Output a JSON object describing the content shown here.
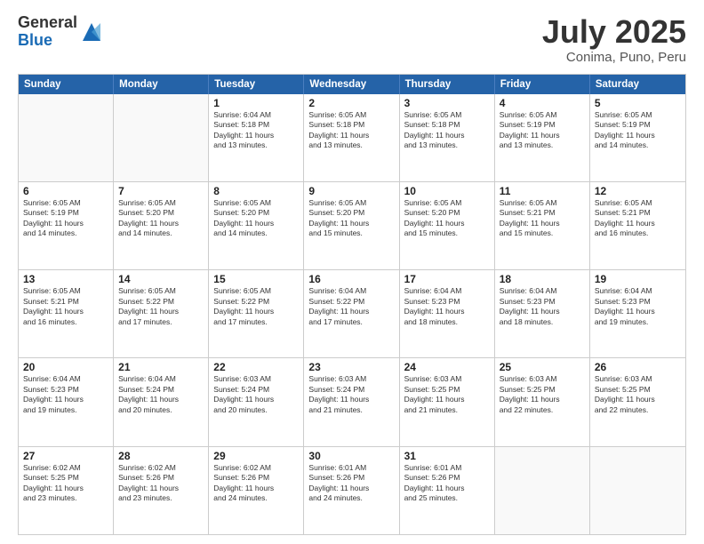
{
  "logo": {
    "general": "General",
    "blue": "Blue"
  },
  "title": "July 2025",
  "subtitle": "Conima, Puno, Peru",
  "header_days": [
    "Sunday",
    "Monday",
    "Tuesday",
    "Wednesday",
    "Thursday",
    "Friday",
    "Saturday"
  ],
  "weeks": [
    [
      {
        "day": "",
        "content": ""
      },
      {
        "day": "",
        "content": ""
      },
      {
        "day": "1",
        "content": "Sunrise: 6:04 AM\nSunset: 5:18 PM\nDaylight: 11 hours\nand 13 minutes."
      },
      {
        "day": "2",
        "content": "Sunrise: 6:05 AM\nSunset: 5:18 PM\nDaylight: 11 hours\nand 13 minutes."
      },
      {
        "day": "3",
        "content": "Sunrise: 6:05 AM\nSunset: 5:18 PM\nDaylight: 11 hours\nand 13 minutes."
      },
      {
        "day": "4",
        "content": "Sunrise: 6:05 AM\nSunset: 5:19 PM\nDaylight: 11 hours\nand 13 minutes."
      },
      {
        "day": "5",
        "content": "Sunrise: 6:05 AM\nSunset: 5:19 PM\nDaylight: 11 hours\nand 14 minutes."
      }
    ],
    [
      {
        "day": "6",
        "content": "Sunrise: 6:05 AM\nSunset: 5:19 PM\nDaylight: 11 hours\nand 14 minutes."
      },
      {
        "day": "7",
        "content": "Sunrise: 6:05 AM\nSunset: 5:20 PM\nDaylight: 11 hours\nand 14 minutes."
      },
      {
        "day": "8",
        "content": "Sunrise: 6:05 AM\nSunset: 5:20 PM\nDaylight: 11 hours\nand 14 minutes."
      },
      {
        "day": "9",
        "content": "Sunrise: 6:05 AM\nSunset: 5:20 PM\nDaylight: 11 hours\nand 15 minutes."
      },
      {
        "day": "10",
        "content": "Sunrise: 6:05 AM\nSunset: 5:20 PM\nDaylight: 11 hours\nand 15 minutes."
      },
      {
        "day": "11",
        "content": "Sunrise: 6:05 AM\nSunset: 5:21 PM\nDaylight: 11 hours\nand 15 minutes."
      },
      {
        "day": "12",
        "content": "Sunrise: 6:05 AM\nSunset: 5:21 PM\nDaylight: 11 hours\nand 16 minutes."
      }
    ],
    [
      {
        "day": "13",
        "content": "Sunrise: 6:05 AM\nSunset: 5:21 PM\nDaylight: 11 hours\nand 16 minutes."
      },
      {
        "day": "14",
        "content": "Sunrise: 6:05 AM\nSunset: 5:22 PM\nDaylight: 11 hours\nand 17 minutes."
      },
      {
        "day": "15",
        "content": "Sunrise: 6:05 AM\nSunset: 5:22 PM\nDaylight: 11 hours\nand 17 minutes."
      },
      {
        "day": "16",
        "content": "Sunrise: 6:04 AM\nSunset: 5:22 PM\nDaylight: 11 hours\nand 17 minutes."
      },
      {
        "day": "17",
        "content": "Sunrise: 6:04 AM\nSunset: 5:23 PM\nDaylight: 11 hours\nand 18 minutes."
      },
      {
        "day": "18",
        "content": "Sunrise: 6:04 AM\nSunset: 5:23 PM\nDaylight: 11 hours\nand 18 minutes."
      },
      {
        "day": "19",
        "content": "Sunrise: 6:04 AM\nSunset: 5:23 PM\nDaylight: 11 hours\nand 19 minutes."
      }
    ],
    [
      {
        "day": "20",
        "content": "Sunrise: 6:04 AM\nSunset: 5:23 PM\nDaylight: 11 hours\nand 19 minutes."
      },
      {
        "day": "21",
        "content": "Sunrise: 6:04 AM\nSunset: 5:24 PM\nDaylight: 11 hours\nand 20 minutes."
      },
      {
        "day": "22",
        "content": "Sunrise: 6:03 AM\nSunset: 5:24 PM\nDaylight: 11 hours\nand 20 minutes."
      },
      {
        "day": "23",
        "content": "Sunrise: 6:03 AM\nSunset: 5:24 PM\nDaylight: 11 hours\nand 21 minutes."
      },
      {
        "day": "24",
        "content": "Sunrise: 6:03 AM\nSunset: 5:25 PM\nDaylight: 11 hours\nand 21 minutes."
      },
      {
        "day": "25",
        "content": "Sunrise: 6:03 AM\nSunset: 5:25 PM\nDaylight: 11 hours\nand 22 minutes."
      },
      {
        "day": "26",
        "content": "Sunrise: 6:03 AM\nSunset: 5:25 PM\nDaylight: 11 hours\nand 22 minutes."
      }
    ],
    [
      {
        "day": "27",
        "content": "Sunrise: 6:02 AM\nSunset: 5:25 PM\nDaylight: 11 hours\nand 23 minutes."
      },
      {
        "day": "28",
        "content": "Sunrise: 6:02 AM\nSunset: 5:26 PM\nDaylight: 11 hours\nand 23 minutes."
      },
      {
        "day": "29",
        "content": "Sunrise: 6:02 AM\nSunset: 5:26 PM\nDaylight: 11 hours\nand 24 minutes."
      },
      {
        "day": "30",
        "content": "Sunrise: 6:01 AM\nSunset: 5:26 PM\nDaylight: 11 hours\nand 24 minutes."
      },
      {
        "day": "31",
        "content": "Sunrise: 6:01 AM\nSunset: 5:26 PM\nDaylight: 11 hours\nand 25 minutes."
      },
      {
        "day": "",
        "content": ""
      },
      {
        "day": "",
        "content": ""
      }
    ]
  ]
}
